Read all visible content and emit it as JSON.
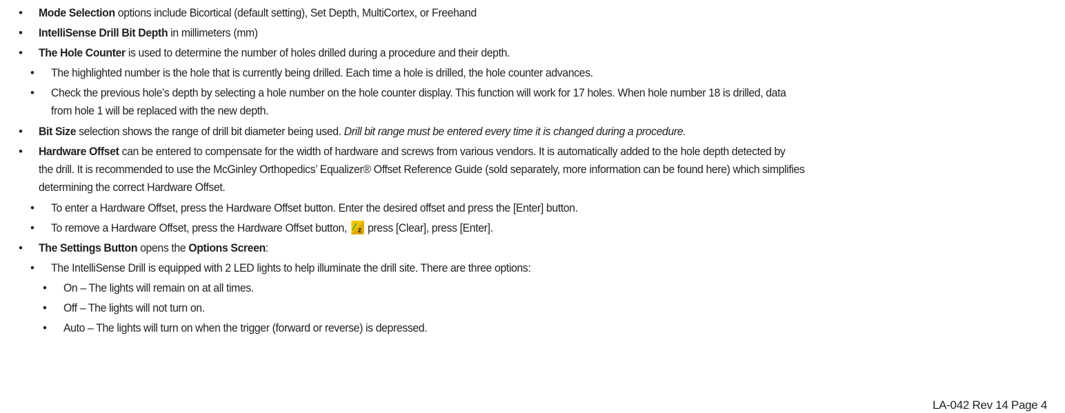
{
  "bullets": {
    "b1": {
      "bold": "Mode Selection",
      "text": " options include Bicortical (default setting), Set Depth, MultiCortex, or Freehand"
    },
    "b2": {
      "bold": "IntelliSense Drill Bit Depth",
      "text": " in millimeters (mm)"
    },
    "b3": {
      "bold": "The Hole Counter",
      "text": " is used to determine the number of holes drilled during a procedure and their depth."
    },
    "b3a": {
      "text": "The highlighted number is the hole that is currently being drilled. Each time a hole is drilled, the hole counter advances."
    },
    "b3b": {
      "text1": "Check the previous hole’s depth by selecting a hole number on the hole counter display. This function will work for 17 holes. When hole number 18 is drilled, data",
      "text2": "from hole 1 will be replaced with the new depth."
    },
    "b4": {
      "bold": "Bit Size",
      "text": " selection shows the range of drill bit diameter being used. ",
      "italic": "Drill bit range must be entered every time it is changed during a procedure."
    },
    "b5": {
      "bold": "Hardware Offset",
      "text1": " can be entered to compensate for the width of hardware and screws from various vendors. It is automatically added to the hole depth detected by",
      "text2": "the drill. It is recommended to use the McGinley Orthopedics’ Equalizer® Offset Reference Guide (sold separately, more information can be found here) which simplifies",
      "text3": "determining the correct Hardware Offset."
    },
    "b5a": {
      "text": "To enter a Hardware Offset, press the Hardware Offset button. Enter the desired offset and press the [Enter] button."
    },
    "b5b": {
      "text_before": "To remove a Hardware Offset, press the Hardware Offset button, ",
      "text_after": "press [Clear], press [Enter]."
    },
    "b6": {
      "bold1": "The Settings Button",
      "text": " opens the ",
      "bold2": "Options Screen",
      "text_end": ":"
    },
    "b6a": {
      "text": "The IntelliSense Drill is equipped with 2 LED lights to help illuminate the drill site. There are three options:"
    },
    "b6a1": {
      "text": "On – The lights will remain on at all times."
    },
    "b6a2": {
      "text": "Off – The lights will not turn on."
    },
    "b6a3": {
      "text": "Auto – The lights will turn on when the trigger (forward or reverse) is depressed."
    }
  },
  "bullet_symbol": "•",
  "icons": {
    "clear_icon": "clear-z-icon"
  },
  "footer": {
    "text": "LA-042 Rev 14 Page 4"
  },
  "colors": {
    "text": "#231f20",
    "icon_yellow": "#f2c400",
    "icon_green": "#5aa53c"
  }
}
